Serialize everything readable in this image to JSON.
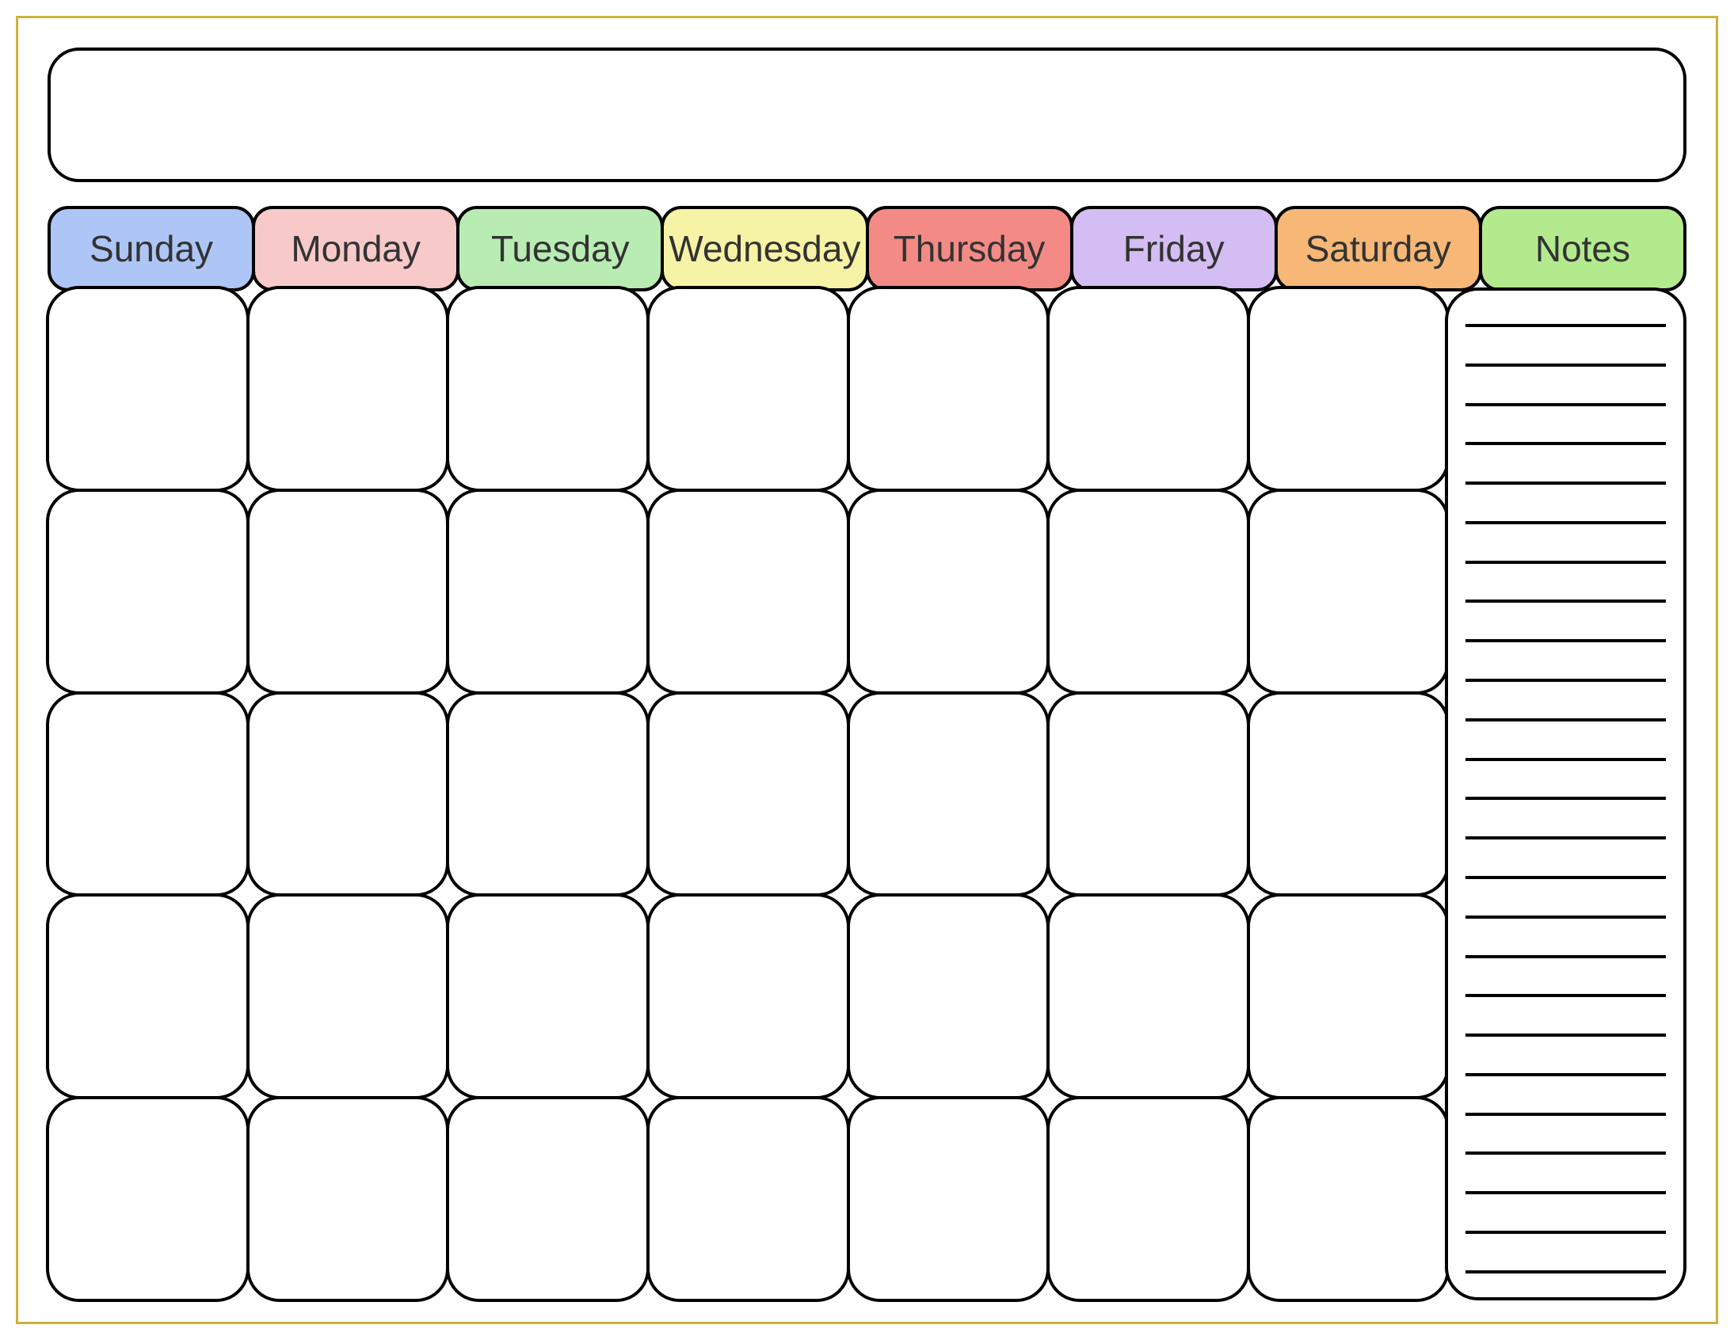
{
  "title": "",
  "headers": [
    {
      "label": "Sunday",
      "color": "#aec6f6"
    },
    {
      "label": "Monday",
      "color": "#f7c9c9"
    },
    {
      "label": "Tuesday",
      "color": "#b9ecb3"
    },
    {
      "label": "Wednesday",
      "color": "#f7f3a6"
    },
    {
      "label": "Thursday",
      "color": "#f48a86"
    },
    {
      "label": "Friday",
      "color": "#d3bdf2"
    },
    {
      "label": "Saturday",
      "color": "#f6b777"
    },
    {
      "label": "Notes",
      "color": "#b3ea8e"
    }
  ],
  "grid": {
    "rows": 5,
    "cols": 7
  },
  "notes_lines": 25
}
